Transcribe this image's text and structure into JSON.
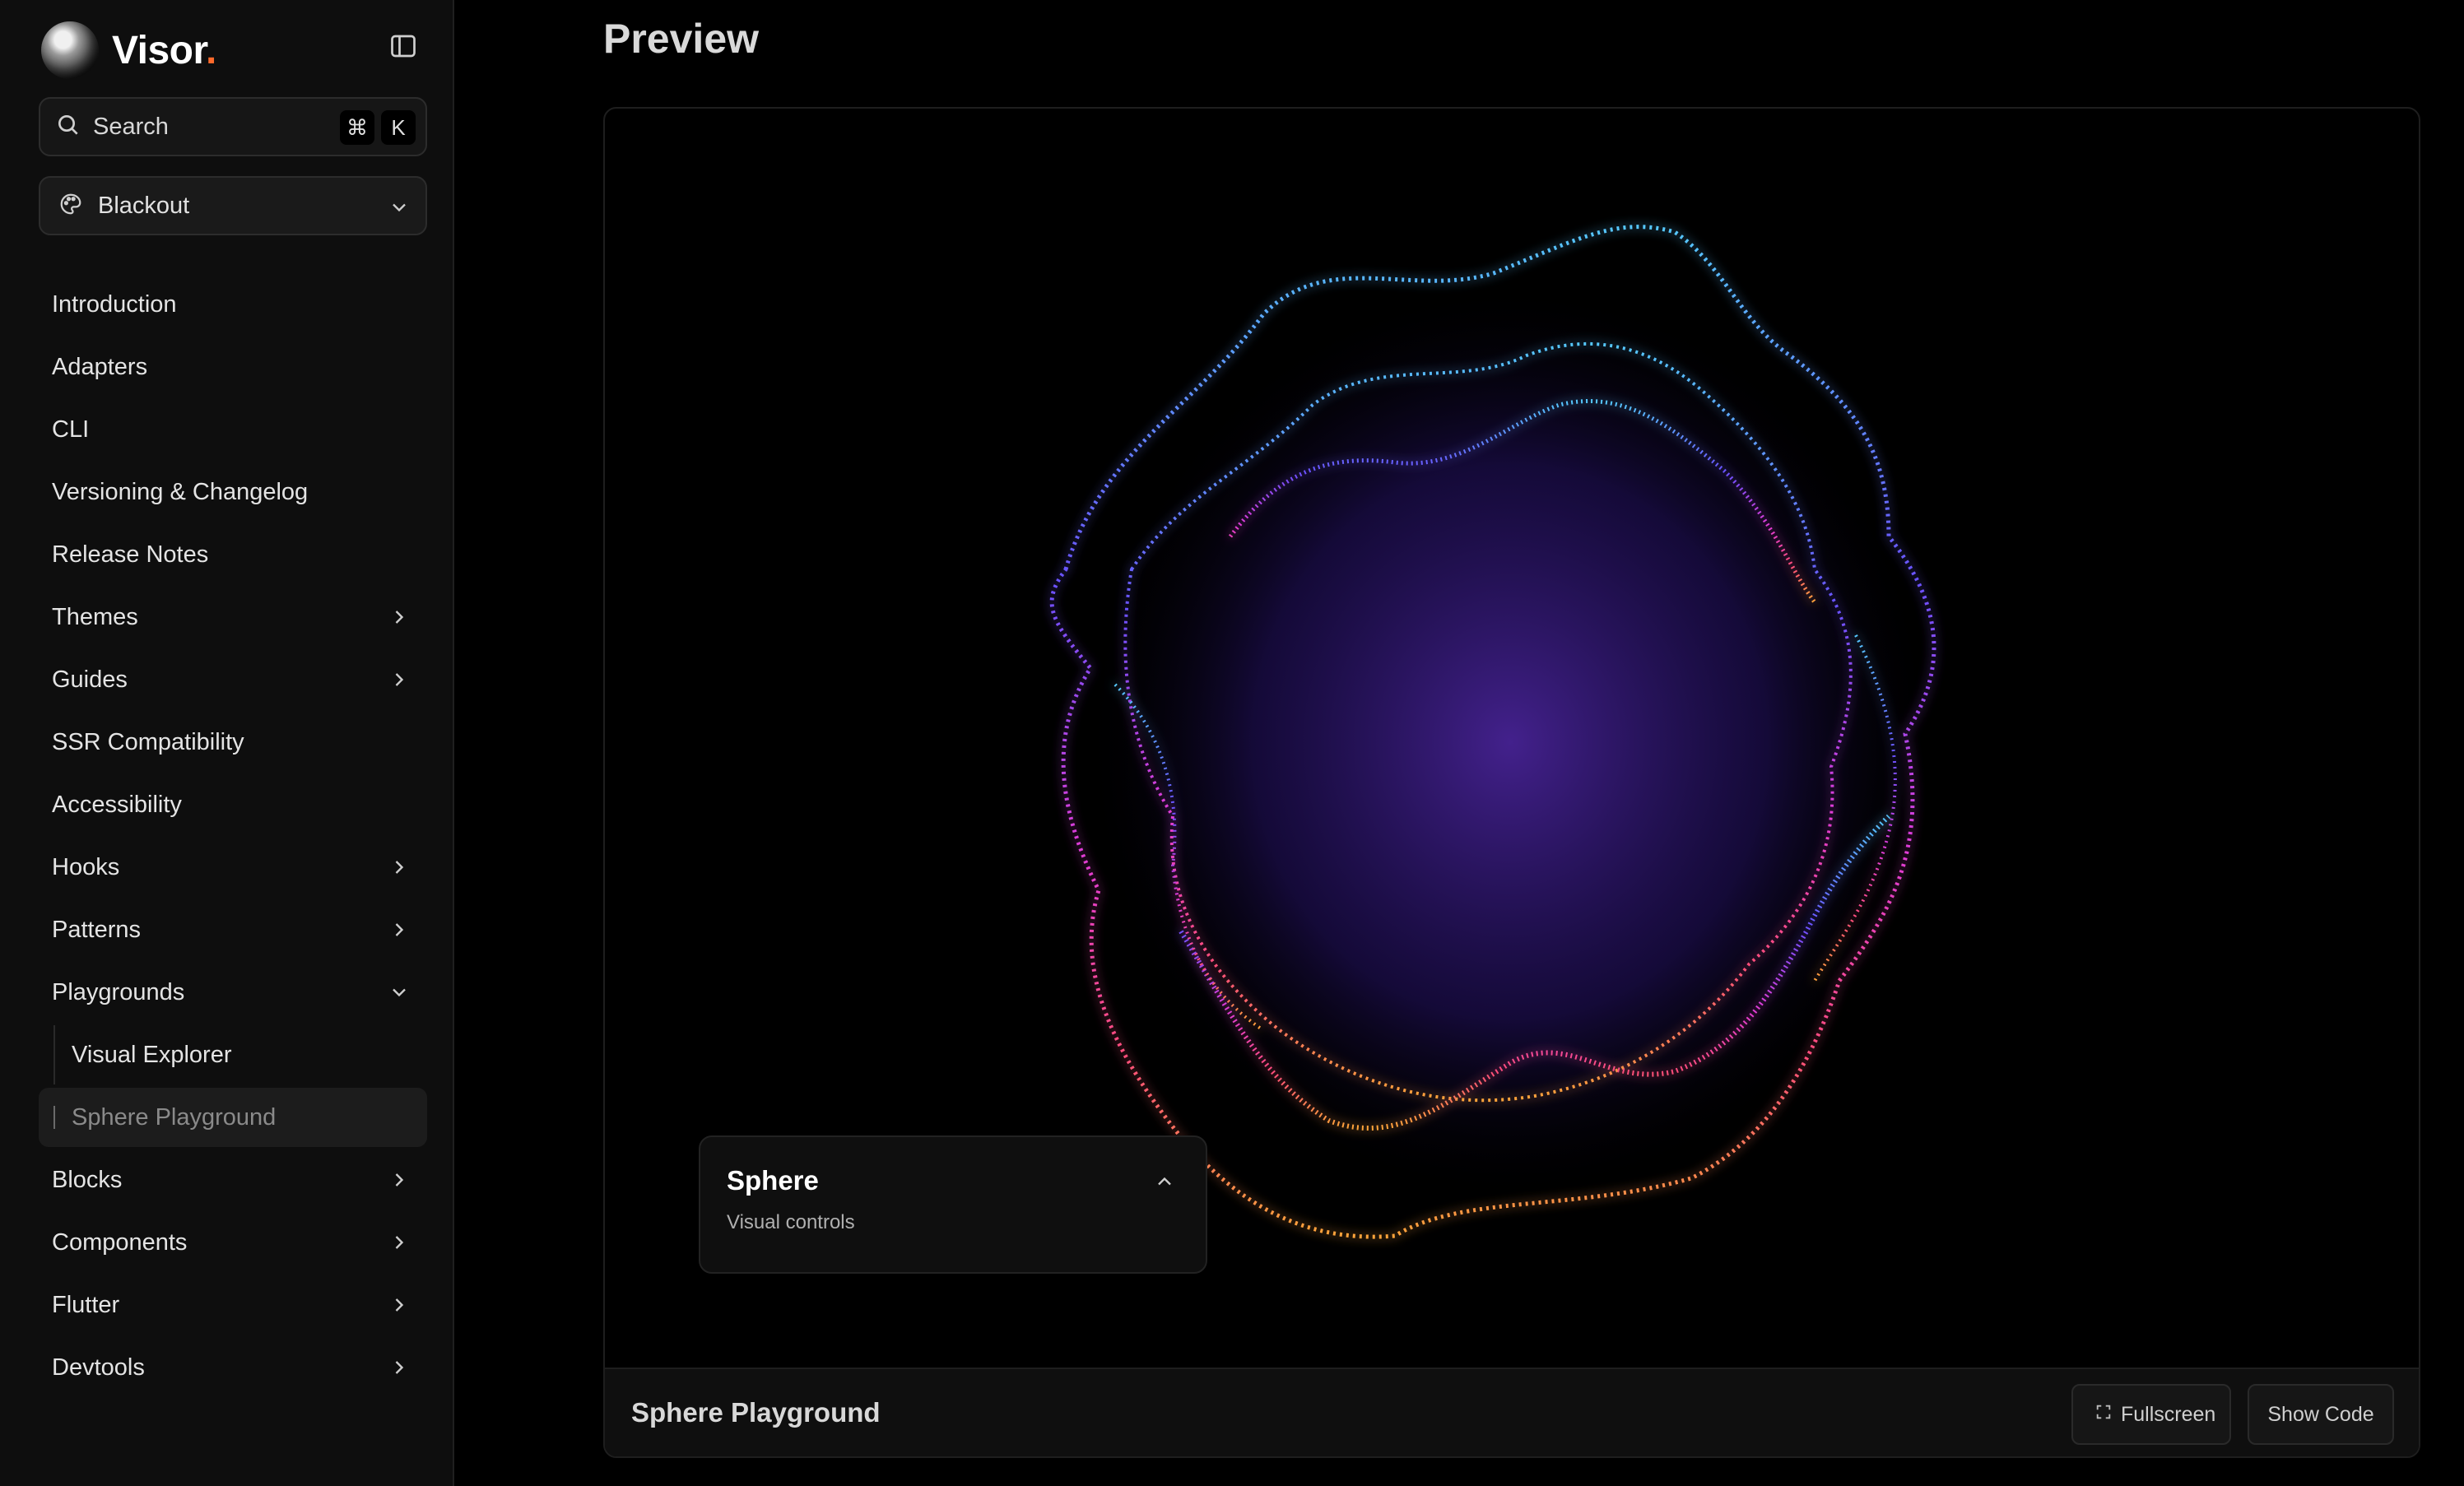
{
  "app": {
    "name": "Visor",
    "name_dot": ".",
    "accent": "#ff6a2b"
  },
  "search": {
    "label": "Search",
    "shortcut_mod": "⌘",
    "shortcut_key": "K"
  },
  "theme": {
    "selected": "Blackout"
  },
  "sidebar": {
    "items": [
      {
        "label": "Introduction"
      },
      {
        "label": "Adapters"
      },
      {
        "label": "CLI"
      },
      {
        "label": "Versioning & Changelog"
      },
      {
        "label": "Release Notes"
      },
      {
        "label": "Themes"
      },
      {
        "label": "Guides"
      },
      {
        "label": "SSR Compatibility"
      },
      {
        "label": "Accessibility"
      },
      {
        "label": "Hooks"
      },
      {
        "label": "Patterns"
      },
      {
        "label": "Playgrounds"
      },
      {
        "label": "Visual Explorer"
      },
      {
        "label": "Sphere Playground"
      },
      {
        "label": "Blocks"
      },
      {
        "label": "Components"
      },
      {
        "label": "Flutter"
      },
      {
        "label": "Devtools"
      }
    ]
  },
  "main": {
    "title": "Preview",
    "controls": {
      "title": "Sphere",
      "subtitle": "Visual controls"
    },
    "footer": {
      "title": "Sphere Playground",
      "fullscreen_label": "Fullscreen",
      "show_code_label": "Show Code"
    }
  }
}
